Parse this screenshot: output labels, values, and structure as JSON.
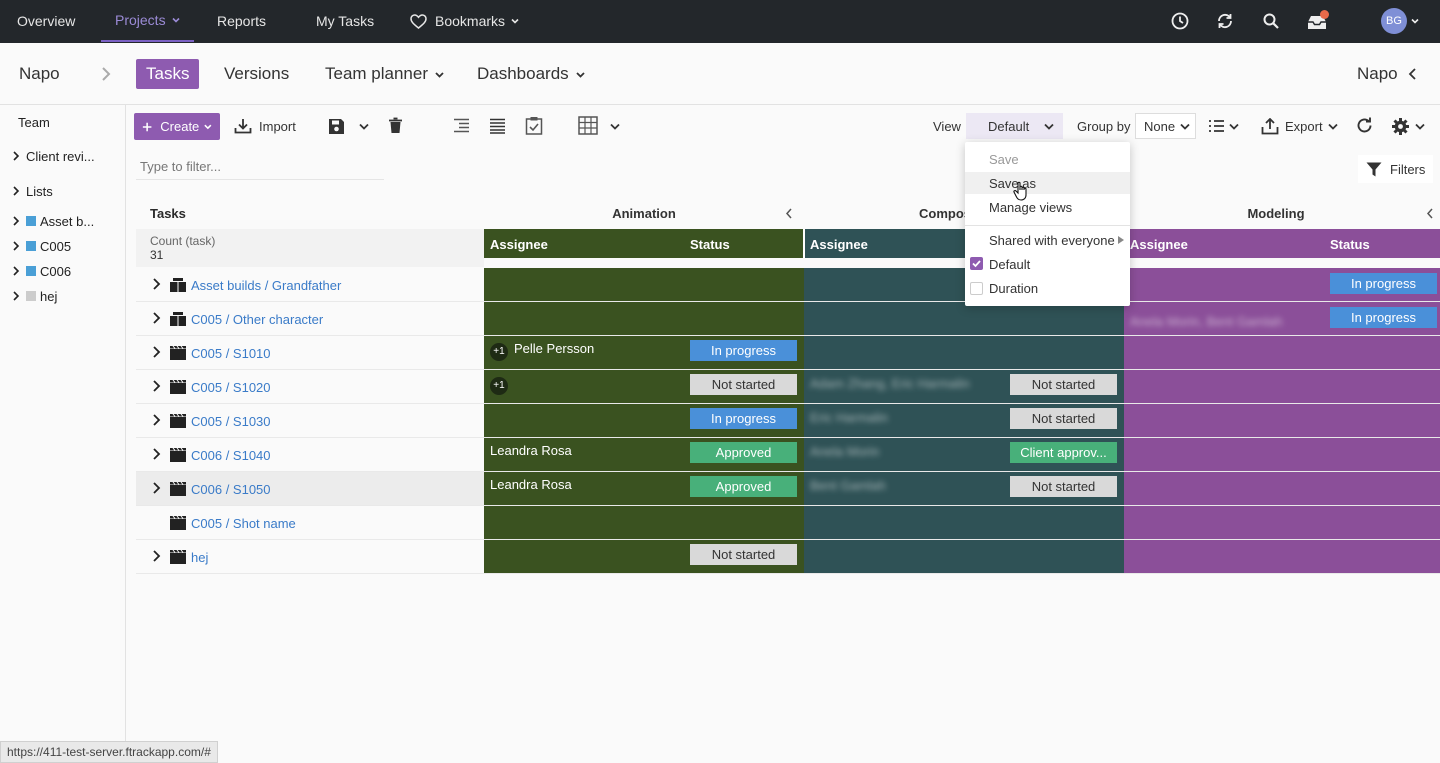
{
  "topnav": {
    "items": [
      "Overview",
      "Projects",
      "Reports",
      "My Tasks",
      "Bookmarks"
    ],
    "avatar": "BG",
    "icons": [
      "clock-icon",
      "sync-icon",
      "search-icon",
      "inbox-icon"
    ],
    "accent": "#7b61c4"
  },
  "subhead": {
    "project": "Napo",
    "tabs": [
      "Tasks",
      "Versions",
      "Team planner",
      "Dashboards"
    ],
    "right_project": "Napo"
  },
  "sidebar": {
    "items": [
      {
        "label": "Team"
      },
      {
        "label": "Client revi..."
      },
      {
        "label": "Lists"
      },
      {
        "label": "Asset b...",
        "color": "#4a9fd6"
      },
      {
        "label": "C005",
        "color": "#4a9fd6"
      },
      {
        "label": "C006",
        "color": "#4a9fd6"
      },
      {
        "label": "hej",
        "color": "#cccccc"
      }
    ]
  },
  "toolbar": {
    "create": "Create",
    "import": "Import",
    "view_label": "View",
    "view_value": "Default",
    "group_label": "Group by",
    "group_value": "None",
    "export": "Export",
    "filter_placeholder": "Type to filter...",
    "filters": "Filters"
  },
  "grid": {
    "header_tasks": "Tasks",
    "groups": [
      "Animation",
      "Compos",
      "Modeling"
    ],
    "col_assignee": "Assignee",
    "col_status": "Status",
    "count_label": "Count (task)",
    "count_value": "31",
    "rows": [
      {
        "name": "Asset builds / Grandfather",
        "anim_assignee": "",
        "anim_status": "",
        "comp_assignee": "",
        "comp_status": "",
        "model_assignee": "",
        "model_status": "In progress"
      },
      {
        "name": "C005 / Other character",
        "anim_assignee": "",
        "anim_status": "",
        "comp_assignee": "",
        "comp_status": "",
        "model_assignee": "Anela Morin, Bent Gamlah",
        "model_status": "In progress"
      },
      {
        "name": "C005 / S1010",
        "anim_plus": "+1",
        "anim_assignee": "Pelle Persson",
        "anim_status": "In progress",
        "comp_assignee": "",
        "comp_status": "",
        "model_assignee": "",
        "model_status": ""
      },
      {
        "name": "C005 / S1020",
        "anim_plus": "+1",
        "anim_assignee": "",
        "anim_status": "Not started",
        "comp_assignee": "Adam Zhang, Eric Harmalin",
        "comp_status": "Not started",
        "model_assignee": "",
        "model_status": ""
      },
      {
        "name": "C005 / S1030",
        "anim_assignee": "",
        "anim_status": "In progress",
        "comp_assignee": "Eric Harmalin",
        "comp_status": "Not started",
        "model_assignee": "",
        "model_status": ""
      },
      {
        "name": "C006 / S1040",
        "anim_assignee": "Leandra Rosa",
        "anim_status": "Approved",
        "comp_assignee": "Anela Morin",
        "comp_status": "Client approv...",
        "model_assignee": "",
        "model_status": ""
      },
      {
        "name": "C006 / S1050",
        "anim_assignee": "Leandra Rosa",
        "anim_status": "Approved",
        "comp_assignee": "Bent Gamlah",
        "comp_status": "Not started",
        "model_assignee": "",
        "model_status": ""
      },
      {
        "name": "C005 / Shot name",
        "anim_assignee": "",
        "anim_status": "",
        "comp_assignee": "",
        "comp_status": "",
        "model_assignee": "",
        "model_status": ""
      },
      {
        "name": "hej",
        "anim_assignee": "",
        "anim_status": "Not started",
        "comp_assignee": "",
        "comp_status": "",
        "model_assignee": "",
        "model_status": ""
      }
    ]
  },
  "view_menu": {
    "save": "Save",
    "save_as": "Save as",
    "manage": "Manage views",
    "shared": "Shared with everyone",
    "default": "Default",
    "duration": "Duration"
  },
  "statusbar": "https://411-test-server.ftrackapp.com/#",
  "colors": {
    "animation": "#3a5220",
    "compositing": "#2f5256",
    "modeling": "#8b4f99",
    "primary": "#8e5bb0"
  }
}
